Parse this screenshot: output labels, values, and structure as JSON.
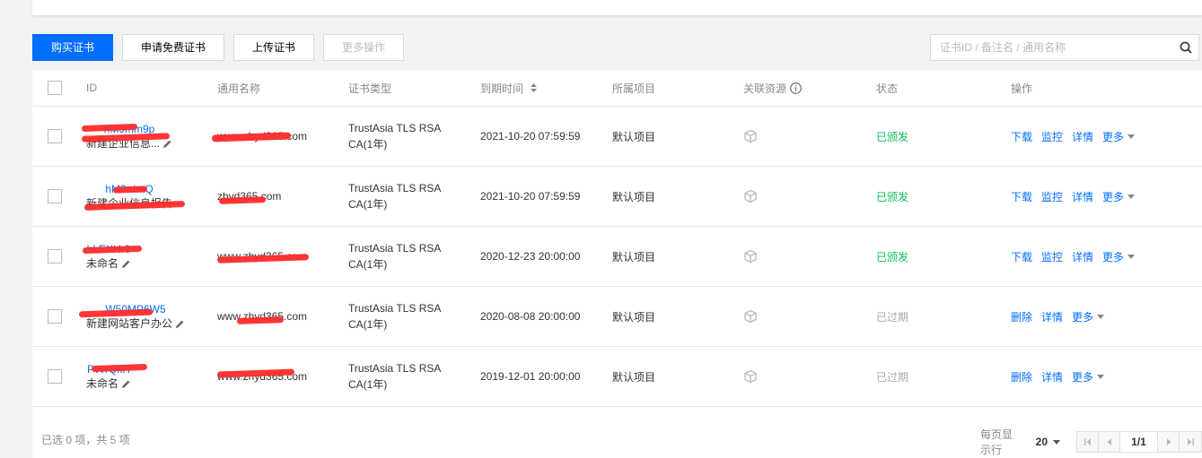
{
  "toolbar": {
    "buy": "购买证书",
    "apply_free": "申请免费证书",
    "upload": "上传证书",
    "more_ops": "更多操作"
  },
  "search": {
    "placeholder": "证书ID / 备注名 / 通用名称"
  },
  "table": {
    "headers": {
      "id": "ID",
      "common_name": "通用名称",
      "cert_type": "证书类型",
      "expire": "到期时间",
      "project": "所属项目",
      "resource": "关联资源",
      "status": "状态",
      "actions": "操作"
    },
    "rows": [
      {
        "id": "hM9mm9p",
        "note": "新建企业信息...",
        "common_name": "www.zhyd365.com",
        "cert_type_1": "TrustAsia TLS RSA",
        "cert_type_2": "CA(1年)",
        "expire": "2021-10-20 07:59:59",
        "project": "默认项目",
        "status": "已颁发",
        "ops": [
          "下载",
          "监控",
          "详情"
        ],
        "more": "更多"
      },
      {
        "id": "hM2rdmQ",
        "note": "新建企业信息报告",
        "common_name": "zhyd365.com",
        "cert_type_1": "TrustAsia TLS RSA",
        "cert_type_2": "CA(1年)",
        "expire": "2021-10-20 07:59:59",
        "project": "默认项目",
        "status": "已颁发",
        "ops": [
          "下载",
          "监控",
          "详情"
        ],
        "more": "更多"
      },
      {
        "id": "hLEXHr9",
        "note": "未命名",
        "common_name": "www.zhyd365.com",
        "cert_type_1": "TrustAsia TLS RSA",
        "cert_type_2": "CA(1年)",
        "expire": "2020-12-23 20:00:00",
        "project": "默认项目",
        "status": "已颁发",
        "ops": [
          "下载",
          "监控",
          "详情"
        ],
        "more": "更多"
      },
      {
        "id": "W50MP6W5",
        "note": "新建网站客户办公",
        "common_name": "www.zhyd365.com",
        "cert_type_1": "TrustAsia TLS RSA",
        "cert_type_2": "CA(1年)",
        "expire": "2020-08-08 20:00:00",
        "project": "默认项目",
        "status": "已过期",
        "ops": [
          "删除",
          "详情"
        ],
        "more": "更多"
      },
      {
        "id": "PvvrQkH",
        "note": "未命名",
        "common_name": "www.zhyd365.com",
        "cert_type_1": "TrustAsia TLS RSA",
        "cert_type_2": "CA(1年)",
        "expire": "2019-12-01 20:00:00",
        "project": "默认项目",
        "status": "已过期",
        "ops": [
          "删除",
          "详情"
        ],
        "more": "更多"
      }
    ]
  },
  "footer": {
    "selection": "已选 0 项，共 5 项",
    "per_page_label": "每页显示行",
    "per_page": "20",
    "page": "1/1"
  },
  "colors": {
    "primary": "#006eff",
    "issued": "#0abf5b",
    "expired": "#aaaaaa",
    "redaction": "#ff2b2b"
  }
}
